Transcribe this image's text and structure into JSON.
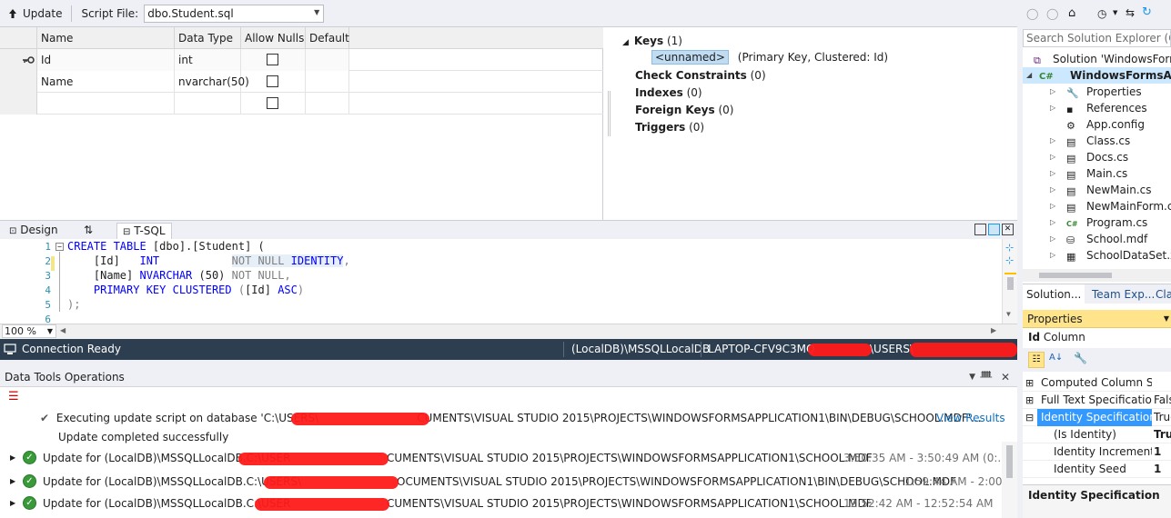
{
  "toolbar": {
    "update_label": "Update",
    "script_file_label": "Script File:",
    "script_file_value": "dbo.Student.sql"
  },
  "grid": {
    "headers": [
      "Name",
      "Data Type",
      "Allow Nulls",
      "Default"
    ],
    "rows": [
      {
        "name": "Id",
        "type": "int",
        "allow_nulls": false,
        "primary_key": true
      },
      {
        "name": "Name",
        "type": "nvarchar(50)",
        "allow_nulls": false,
        "primary_key": false
      },
      {
        "name": "",
        "type": "",
        "allow_nulls": false,
        "primary_key": false
      }
    ]
  },
  "keys_panel": {
    "keys_label": "Keys",
    "keys_count": "(1)",
    "key_name": "<unnamed>",
    "key_desc": "(Primary Key, Clustered: Id)",
    "check_label": "Check Constraints",
    "check_count": "(0)",
    "indexes_label": "Indexes",
    "indexes_count": "(0)",
    "fk_label": "Foreign Keys",
    "fk_count": "(0)",
    "triggers_label": "Triggers",
    "triggers_count": "(0)"
  },
  "tabs": {
    "design": "Design",
    "swap": "⇅",
    "tsql": "T-SQL"
  },
  "editor": {
    "line_numbers": [
      "1",
      "2",
      "3",
      "4",
      "5",
      "6"
    ],
    "l1_kw": "CREATE TABLE",
    "l1_rest": " [dbo].[Student] (",
    "l2_id": "    [Id]   ",
    "l2_type": "INT",
    "l2_gap": "           ",
    "l2_nn": "NOT NULL",
    "l2_ident": " IDENTITY",
    "l2_end": ",",
    "l3_id": "    [Name] ",
    "l3_type": "NVARCHAR",
    "l3_size": " (50) ",
    "l3_nn": "NOT NULL",
    "l3_end": ",",
    "l4_kw": "    PRIMARY KEY CLUSTERED",
    "l4_paren": " (",
    "l4_col": "[Id]",
    "l4_asc": " ASC",
    "l4_end": ")",
    "l5": ");",
    "zoom": "100 %"
  },
  "status": {
    "connection": "Connection Ready",
    "server": "(LocalDB)\\MSSQLLocalDB",
    "laptop": "LAPTOP-CFV9C3MQ",
    "users": "\\USERS\\"
  },
  "data_tools": {
    "title": "Data Tools Operations",
    "exec_line": "Executing update script on database 'C:\\USERS\\",
    "exec_rest": "CUMENTS\\VISUAL STUDIO 2015\\PROJECTS\\WINDOWSFORMSAPPLICATION1\\BIN\\DEBUG\\SCHOOL.MDF'...",
    "view_results": "View Results",
    "update_done": "Update completed successfully",
    "ops": [
      {
        "prefix": "Update for (LocalDB)\\MSSQLLocalDB.C:\\USER",
        "rest": "CUMENTS\\VISUAL STUDIO 2015\\PROJECTS\\WINDOWSFORMSAPPLICATION1\\SCHOOL.MDF",
        "time": "3:50:35 AM - 3:50:49 AM (0:..."
      },
      {
        "prefix": "Update for (LocalDB)\\MSSQLLocalDB.C:\\USERS\\",
        "rest": "OCUMENTS\\VISUAL STUDIO 2015\\PROJECTS\\WINDOWSFORMSAPPLICATION1\\BIN\\DEBUG\\SCHOOL.MDF",
        "time": "1:59:44 AM - 2:00"
      },
      {
        "prefix": "Update for (LocalDB)\\MSSQLLocalDB.C:\\USER",
        "rest": "CUMENTS\\VISUAL STUDIO 2015\\PROJECTS\\WINDOWSFORMSAPPLICATION1\\SCHOOL.MDF",
        "time": "12:52:42 AM - 12:52:54 AM"
      }
    ]
  },
  "solution_explorer": {
    "search_placeholder": "Search Solution Explorer (Ctrl+",
    "items": [
      {
        "label": "Solution 'WindowsForms",
        "icon": "solution-icon",
        "level": 0,
        "expander": ""
      },
      {
        "label": "WindowsFormsAppl",
        "icon": "csharp-project-icon",
        "level": 0,
        "expander": "◢",
        "bold": true
      },
      {
        "label": "Properties",
        "icon": "wrench-icon",
        "level": 1,
        "expander": "▷"
      },
      {
        "label": "References",
        "icon": "references-icon",
        "level": 1,
        "expander": "▷"
      },
      {
        "label": "App.config",
        "icon": "config-icon",
        "level": 1,
        "expander": ""
      },
      {
        "label": "Class.cs",
        "icon": "form-file-icon",
        "level": 1,
        "expander": "▷"
      },
      {
        "label": "Docs.cs",
        "icon": "form-file-icon",
        "level": 1,
        "expander": "▷"
      },
      {
        "label": "Main.cs",
        "icon": "form-file-icon",
        "level": 1,
        "expander": "▷"
      },
      {
        "label": "NewMain.cs",
        "icon": "form-file-icon",
        "level": 1,
        "expander": "▷"
      },
      {
        "label": "NewMainForm.cs",
        "icon": "form-file-icon",
        "level": 1,
        "expander": "▷"
      },
      {
        "label": "Program.cs",
        "icon": "csharp-file-icon",
        "level": 1,
        "expander": "▷"
      },
      {
        "label": "School.mdf",
        "icon": "database-icon",
        "level": 1,
        "expander": "▷"
      },
      {
        "label": "SchoolDataSet.xsd",
        "icon": "dataset-icon",
        "level": 1,
        "expander": "▷"
      }
    ],
    "tabs": [
      "Solution...",
      "Team Exp...",
      "Cla"
    ]
  },
  "properties": {
    "title": "Properties",
    "subject_name": "Id",
    "subject_type": "Column",
    "rows": [
      {
        "name": "Computed Column Sp",
        "value": "",
        "expander": "⊞",
        "indent": 0
      },
      {
        "name": "Full Text Specification",
        "value": "Fals",
        "expander": "⊞",
        "indent": 0
      },
      {
        "name": "Identity Specification",
        "value": "True",
        "expander": "⊟",
        "indent": 0,
        "selected": true
      },
      {
        "name": "(Is Identity)",
        "value": "True",
        "expander": "",
        "indent": 1
      },
      {
        "name": "Identity Increment",
        "value": "1",
        "expander": "",
        "indent": 1
      },
      {
        "name": "Identity Seed",
        "value": "1",
        "expander": "",
        "indent": 1
      }
    ],
    "description_title": "Identity Specification"
  },
  "colors": {
    "status_bg": "#2d3e50",
    "accent_blue": "#3399ff",
    "keyword": "#0000ff",
    "properties_header": "#ffe48c"
  }
}
